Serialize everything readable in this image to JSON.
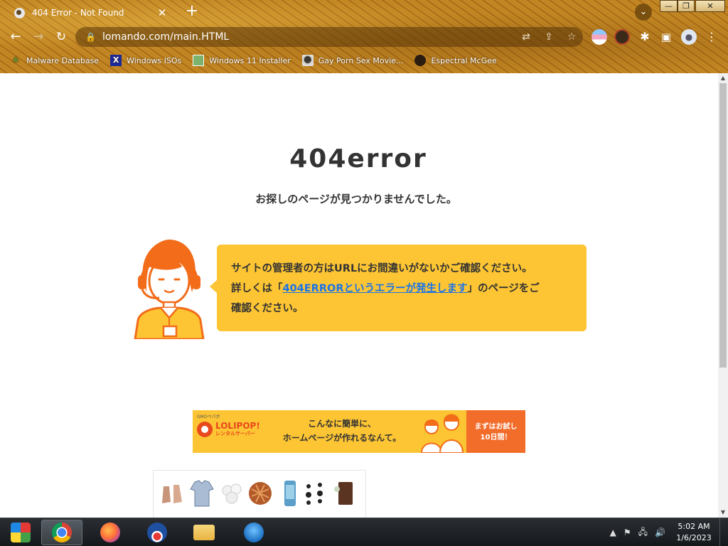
{
  "browser": {
    "tab": {
      "title": "404 Error - Not Found",
      "close_glyph": "✕"
    },
    "new_tab_glyph": "+",
    "tab_search_glyph": "⌄",
    "window_controls": {
      "minimize": "—",
      "maximize": "❐",
      "close": "✕"
    },
    "nav": {
      "back": "←",
      "forward": "→",
      "reload": "↻"
    },
    "address": {
      "lock": "🔒",
      "url": "lomando.com/main.HTML"
    },
    "omnibox_icons": {
      "translate": "⇄",
      "share": "⇪",
      "bookmark": "☆"
    },
    "toolbar_icons": {
      "extensions": "✱",
      "sidepanel": "▣",
      "profile": "●",
      "menu": "⋮"
    },
    "bookmarks": [
      {
        "label": "Malware Database",
        "icon": "leaf-icon"
      },
      {
        "label": "Windows ISOs",
        "icon": "x-icon"
      },
      {
        "label": "Windows 11 Installer",
        "icon": "image-icon"
      },
      {
        "label": "Gay Porn Sex Movie...",
        "icon": "robot-icon"
      },
      {
        "label": "Espectral McGee",
        "icon": "face-icon"
      }
    ]
  },
  "page": {
    "title": "404error",
    "subtitle": "お探しのページが見つかりませんでした。",
    "message": {
      "line1": "サイトの管理者の方はURLにお間違いがないかご確認ください。",
      "line2_prefix": "詳しくは「",
      "link_text": "404ERRORというエラーが発生します",
      "line2_suffix": "」のページをご",
      "line3": "確認ください。"
    },
    "banner": {
      "brand_small": "GMOペパボ",
      "brand": "LOLIPOP!",
      "brand_sub": "レンタルサーバー",
      "copy_line1": "こんなに簡単に、",
      "copy_line2": "ホームページが作れるなんて。",
      "cta_line1": "まずはお試し",
      "cta_line2": "10日間！"
    }
  },
  "taskbar": {
    "tray_up": "▲",
    "time": "5:02 AM",
    "date": "1/6/2023"
  },
  "colors": {
    "bubble": "#fdc533",
    "link": "#1a73e8",
    "avatar_orange": "#f26c1a",
    "banner_cta": "#f26c2a"
  }
}
